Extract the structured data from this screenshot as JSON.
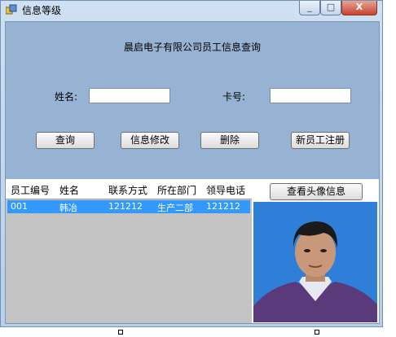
{
  "window": {
    "title": "信息等级",
    "minimize": "_",
    "maximize": "□",
    "close": "X"
  },
  "form": {
    "heading": "晨启电子有限公司员工信息查询",
    "name_label": "姓名:",
    "name_value": "",
    "card_label": "卡号:",
    "card_value": ""
  },
  "buttons": {
    "query": "查询",
    "modify": "信息修改",
    "delete": "删除",
    "register": "新员工注册",
    "view_photo": "查看头像信息"
  },
  "table": {
    "columns": [
      "员工编号",
      "姓名",
      "联系方式",
      "所在部门",
      "领导电话"
    ],
    "rows": [
      [
        "001",
        "韩冶",
        "121212",
        "生产二部",
        "121212"
      ]
    ]
  },
  "colors": {
    "client_bg": "#97b3d3",
    "selection": "#3399ff",
    "photo_bg": "#2f7fd8"
  }
}
